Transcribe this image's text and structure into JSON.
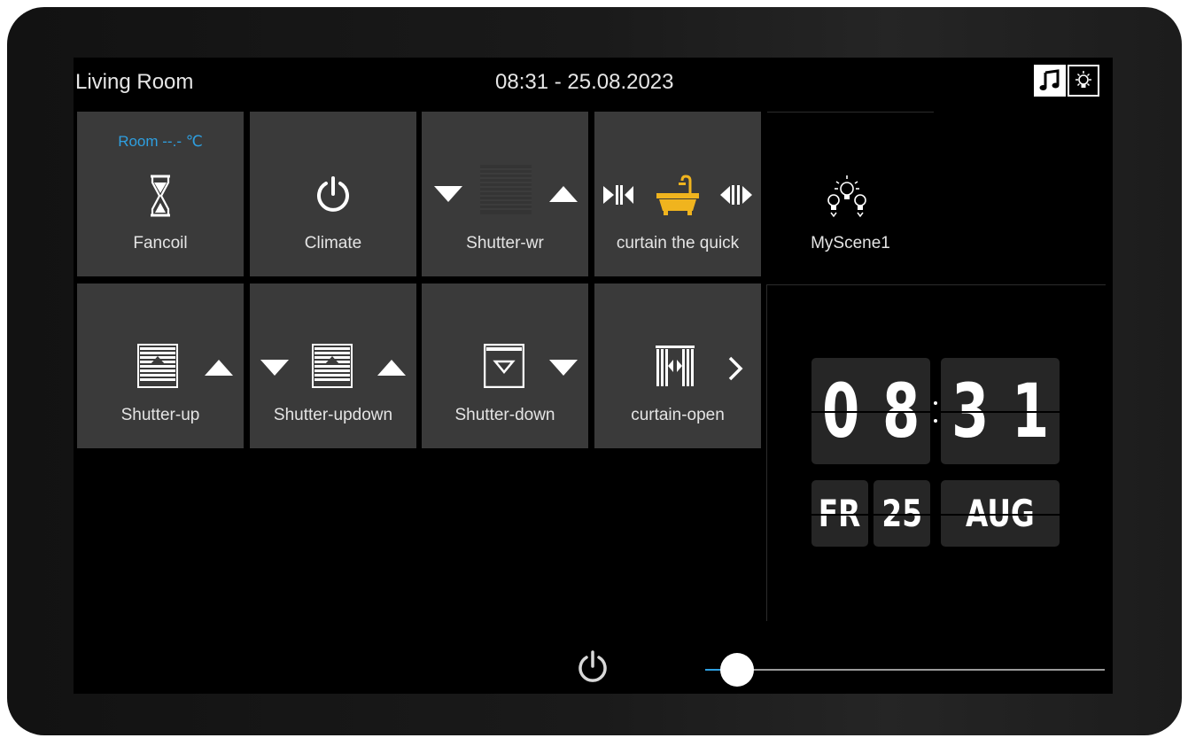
{
  "header": {
    "room_name": "Living Room",
    "datetime": "08:31 - 25.08.2023",
    "music_icon": "music-note-icon",
    "light_icon": "light-bulb-icon"
  },
  "tiles": [
    {
      "label": "Fancoil",
      "sublabel": "Room --.- ℃",
      "icon": "hourglass-icon"
    },
    {
      "label": "Climate",
      "icon": "power-icon"
    },
    {
      "label": "Shutter-wr",
      "icon": "shutter-icon"
    },
    {
      "label": "curtain the quick",
      "icon": "bathtub-icon"
    },
    {
      "label": "MyScene1",
      "icon": "scene-bulbs-icon"
    },
    {
      "label": "Shutter-up",
      "icon": "shutter-up-icon"
    },
    {
      "label": "Shutter-updown",
      "icon": "shutter-updown-icon"
    },
    {
      "label": "Shutter-down",
      "icon": "shutter-down-icon"
    },
    {
      "label": "curtain-open",
      "icon": "curtain-open-icon"
    }
  ],
  "clock": {
    "h1": "0",
    "h2": "8",
    "m1": "3",
    "m2": "1",
    "weekday": "FR",
    "day": "25",
    "month": "AUG"
  },
  "bottom": {
    "power_icon": "power-icon",
    "slider_value": 0.08
  },
  "colors": {
    "accent": "#2e9fe0",
    "tile": "#3a3a3a",
    "bath": "#f0b41e"
  }
}
